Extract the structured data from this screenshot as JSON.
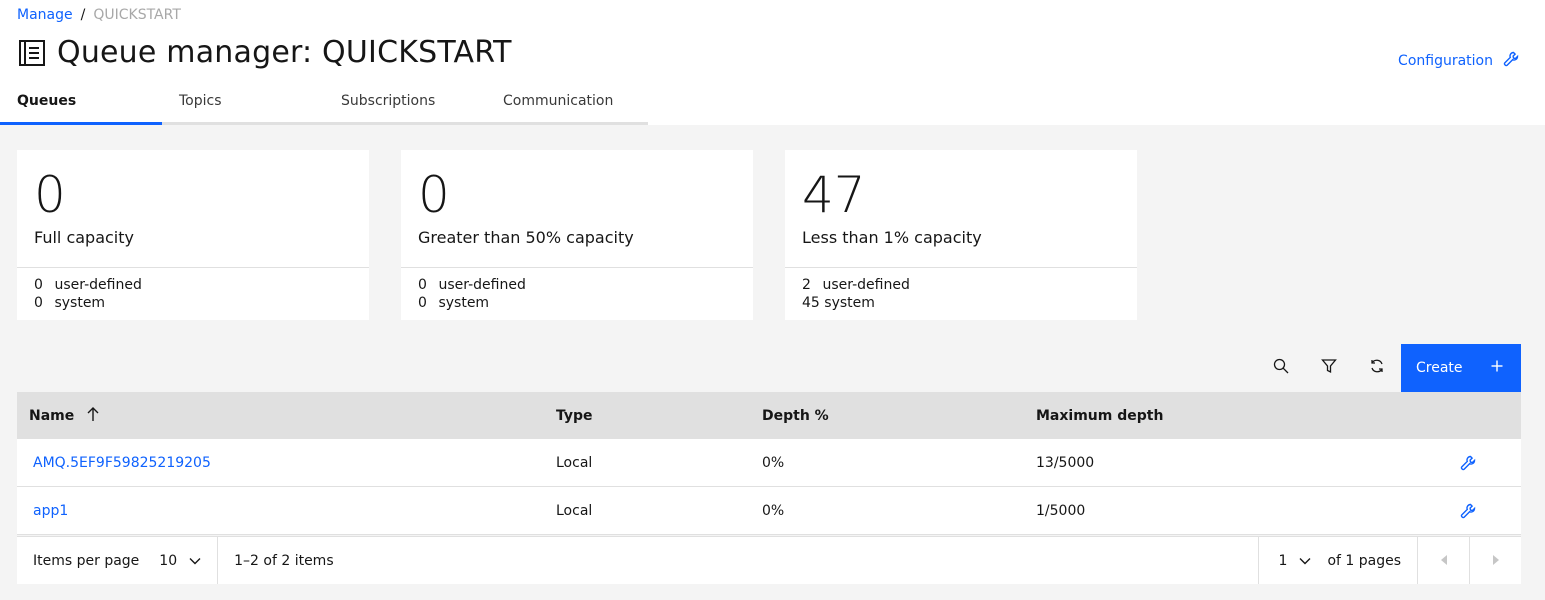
{
  "breadcrumb": {
    "link": "Manage",
    "separator": "/",
    "current": "QUICKSTART"
  },
  "header": {
    "title": "Queue manager: QUICKSTART",
    "config_label": "Configuration"
  },
  "tabs": [
    {
      "label": "Queues",
      "active": true
    },
    {
      "label": "Topics",
      "active": false
    },
    {
      "label": "Subscriptions",
      "active": false
    },
    {
      "label": "Communication",
      "active": false
    }
  ],
  "cards": [
    {
      "count": "0",
      "label": "Full capacity",
      "user_defined": "0",
      "system": "0"
    },
    {
      "count": "0",
      "label": "Greater than 50% capacity",
      "user_defined": "0",
      "system": "0"
    },
    {
      "count": "47",
      "label": "Less than 1% capacity",
      "user_defined": "2",
      "system": "45"
    }
  ],
  "card_labels": {
    "user_defined": "user-defined",
    "system": "system"
  },
  "toolbar": {
    "search_icon": "search-icon",
    "filter_icon": "filter-icon",
    "refresh_icon": "refresh-icon",
    "create_label": "Create"
  },
  "table": {
    "headers": {
      "name": "Name",
      "type": "Type",
      "depth": "Depth %",
      "max_depth": "Maximum depth"
    },
    "rows": [
      {
        "name": "AMQ.5EF9F59825219205",
        "type": "Local",
        "depth": "0%",
        "max_depth": "13/5000"
      },
      {
        "name": "app1",
        "type": "Local",
        "depth": "0%",
        "max_depth": "1/5000"
      }
    ]
  },
  "pagination": {
    "items_per_page_label": "Items per page",
    "page_size": "10",
    "range": "1–2 of 2 items",
    "page": "1",
    "of_pages": "of 1 pages"
  },
  "colors": {
    "accent": "#0f62fe",
    "background": "#f4f4f4",
    "header_bg": "#e0e0e0"
  }
}
